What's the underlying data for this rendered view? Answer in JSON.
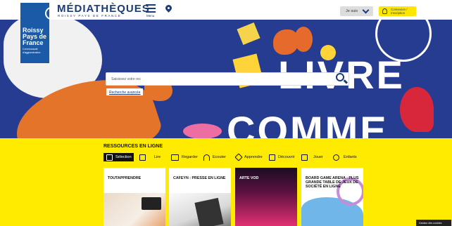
{
  "header": {
    "brand": {
      "line1": "Roissy",
      "line2": "Pays de",
      "line3": "France",
      "line4": "Communauté d'agglomération"
    },
    "title": "MÉDIATHÈQUES",
    "subtitle": "ROISSY PAYS DE FRANCE",
    "menu_label": "Menu",
    "profile_select": "Je suis",
    "login_label": "Connexion / Inscription"
  },
  "hero": {
    "headline_1": "LIVRE",
    "headline_2": "COMME",
    "search_placeholder": "Saisissez votre rec",
    "advanced_search": "Recherche avancée"
  },
  "resources": {
    "title": "RESSOURCES EN LIGNE",
    "tabs": [
      {
        "label": "Sélection",
        "icon": "grid-icon",
        "selected": true
      },
      {
        "label": "Lire",
        "icon": "book-icon"
      },
      {
        "label": "Regarder",
        "icon": "screen-icon"
      },
      {
        "label": "Ecouter",
        "icon": "headphones-icon"
      },
      {
        "label": "Apprendre",
        "icon": "graduation-icon"
      },
      {
        "label": "Découvrir",
        "icon": "explore-icon"
      },
      {
        "label": "Jouer",
        "icon": "game-icon"
      },
      {
        "label": "Enfants",
        "icon": "kids-icon"
      }
    ],
    "cards": [
      {
        "title": "TOUTAPPRENDRE"
      },
      {
        "title": "CAFEYN : PRESSE EN LIGNE"
      },
      {
        "title": "ARTE VOD"
      },
      {
        "title": "BOARD GAME ARENA : PLUS GRANDE TABLE DE JEUX DE SOCIÉTÉ EN LIGNE"
      }
    ]
  },
  "cookie_label": "Gestion des cookies"
}
